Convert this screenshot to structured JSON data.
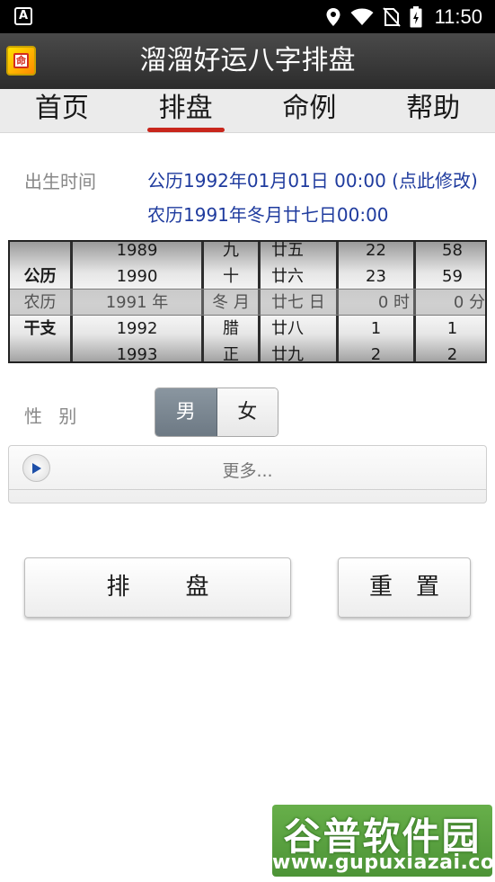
{
  "status_bar": {
    "left_icon": "A",
    "time": "11:50",
    "icons": [
      "location-icon",
      "wifi-icon",
      "no-sim-icon",
      "battery-charging-icon"
    ]
  },
  "app": {
    "title": "溜溜好运八字排盘",
    "icon_char": "命"
  },
  "tabs": [
    {
      "label": "首页",
      "active": false
    },
    {
      "label": "排盘",
      "active": true
    },
    {
      "label": "命例",
      "active": false
    },
    {
      "label": "帮助",
      "active": false
    }
  ],
  "birth": {
    "label": "出生时间",
    "solar": "公历1992年01月01日 00:00 (点此修改)",
    "lunar": "农历1991年冬月廿七日00:00"
  },
  "picker": {
    "row_labels": [
      "公历",
      "农历",
      "干支"
    ],
    "year": [
      "1989",
      "1990",
      "1991 年",
      "1992",
      "1993"
    ],
    "month": [
      "九",
      "十",
      "冬 月",
      "腊",
      "正"
    ],
    "day": [
      "廿五",
      "廿六",
      "廿七 日",
      "廿八",
      "廿九"
    ],
    "hour": [
      "22",
      "23",
      "0 时",
      "1",
      "2"
    ],
    "minute": [
      "58",
      "59",
      "0 分",
      "1",
      "2"
    ]
  },
  "gender": {
    "label": "性 别",
    "options": [
      "男",
      "女"
    ],
    "selected": "男"
  },
  "more": {
    "label": "更多..."
  },
  "buttons": {
    "calculate": "排盘",
    "reset": "重置"
  },
  "watermark": {
    "logo": "谷普软件园",
    "url": "www.gupuxiazai.com"
  },
  "colors": {
    "accent": "#c8261c",
    "link_blue": "#1f3b9e",
    "titlebar": "#3a3a3a"
  }
}
